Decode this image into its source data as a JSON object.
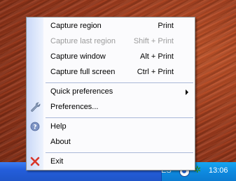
{
  "menu": {
    "items": [
      {
        "label": "Capture region",
        "shortcut": "Print"
      },
      {
        "label": "Capture last region",
        "shortcut": "Shift + Print"
      },
      {
        "label": "Capture window",
        "shortcut": "Alt + Print"
      },
      {
        "label": "Capture full screen",
        "shortcut": "Ctrl + Print"
      },
      {
        "label": "Quick preferences"
      },
      {
        "label": "Preferences..."
      },
      {
        "label": "Help"
      },
      {
        "label": "About"
      },
      {
        "label": "Exit"
      }
    ]
  },
  "taskbar": {
    "language": "ES",
    "clock": "13:06"
  },
  "colors": {
    "taskbar": "#245edb",
    "tray": "#0e8ae0",
    "menu_strip": "#c9d8f7",
    "exit_icon": "#d9352a"
  },
  "icons": {
    "preferences": "wrench-icon",
    "help": "help-icon",
    "exit": "close-icon",
    "quick_preferences": "chevron-right-icon"
  }
}
